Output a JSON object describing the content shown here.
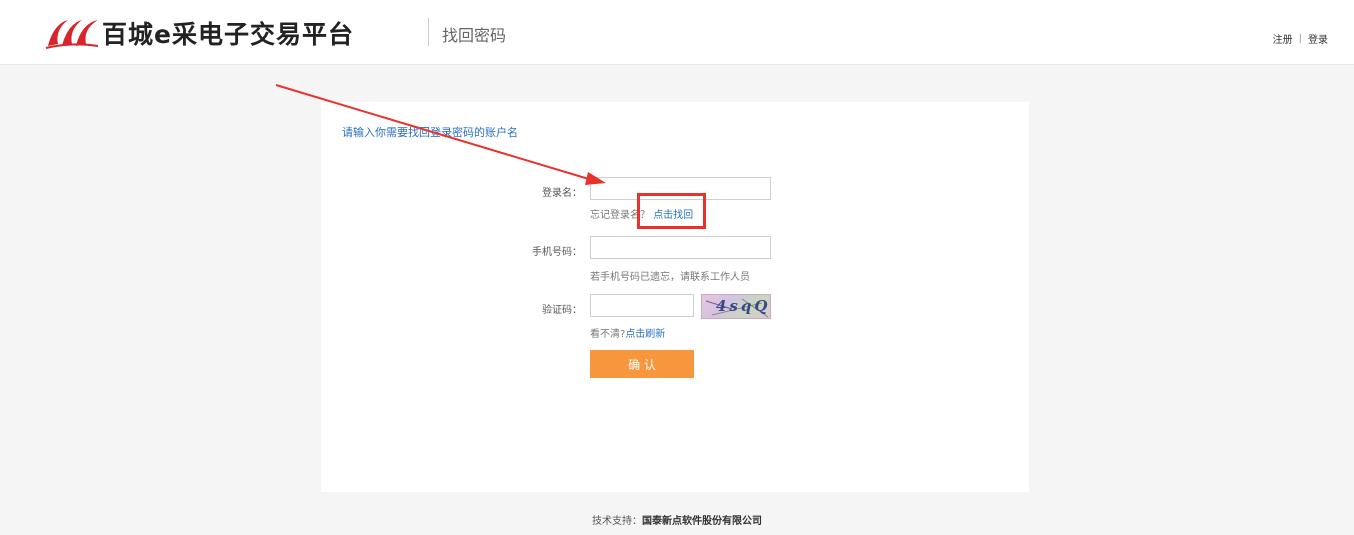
{
  "header": {
    "logo_text": "百城e采电子交易平台",
    "subtitle": "找回密码",
    "register_link": "注册",
    "separator": "|",
    "login_link": "登录"
  },
  "form": {
    "instruction": "请输入你需要找回登录密码的账户名",
    "login_name": {
      "label": "登录名：",
      "value": "",
      "hint_text": "忘记登录名？",
      "hint_link": "点击找回"
    },
    "phone": {
      "label": "手机号码：",
      "value": "",
      "hint_text": "若手机号码已遗忘，请联系工作人员"
    },
    "captcha": {
      "label": "验证码：",
      "value": "",
      "image_text": "4sqQ",
      "hint_text": "看不清?",
      "hint_link": "点击刷新"
    },
    "submit_label": "确 认"
  },
  "footer": {
    "prefix": "技术支持：",
    "company": "国泰新点软件股份有限公司"
  },
  "colors": {
    "accent": "#f7963d",
    "link": "#2a6fbf",
    "annotation": "#e8322c"
  }
}
